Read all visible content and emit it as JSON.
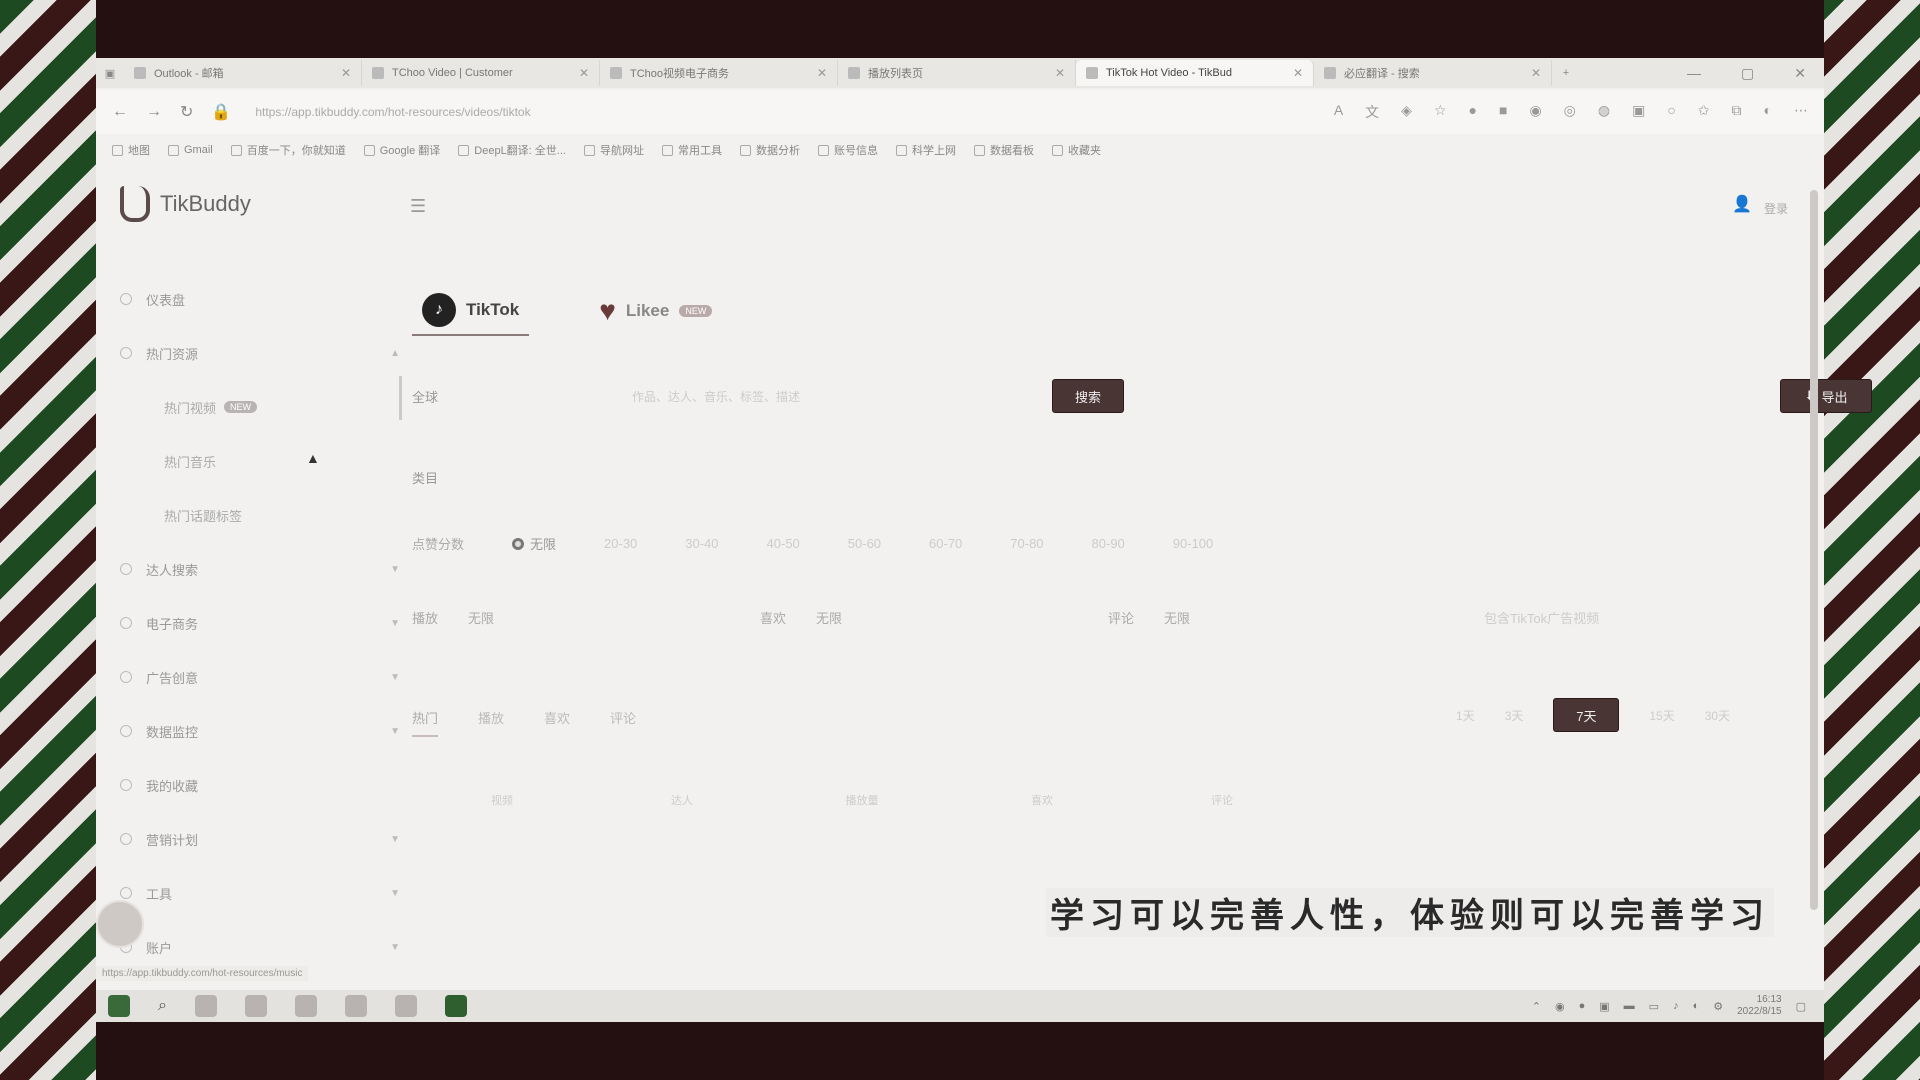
{
  "browser": {
    "tabs": [
      {
        "label": "Outlook - 邮箱",
        "active": false
      },
      {
        "label": "TChoo Video | Customer",
        "active": false
      },
      {
        "label": "TChoo视频电子商务",
        "active": false
      },
      {
        "label": "播放列表页",
        "active": false
      },
      {
        "label": "TikTok Hot Video - TikBud",
        "active": true
      },
      {
        "label": "必应翻译 - 搜索",
        "active": false
      }
    ],
    "new_tab": "+",
    "url": "https://app.tikbuddy.com/hot-resources/videos/tiktok",
    "bookmarks": [
      "地图",
      "Gmail",
      "百度一下，你就知道",
      "Google 翻译",
      "DeepL翻译: 全世...",
      "导航网址",
      "常用工具",
      "数据分析",
      "账号信息",
      "科学上网",
      "数据看板",
      "收藏夹"
    ],
    "status_url": "https://app.tikbuddy.com/hot-resources/music"
  },
  "app": {
    "logo": "TikBuddy",
    "menu_icon": "☰",
    "user_label": "登录"
  },
  "sidebar": {
    "items": [
      {
        "label": "仪表盘",
        "arrow": ""
      },
      {
        "label": "热门资源",
        "arrow": "▲"
      }
    ],
    "subitems": [
      {
        "label": "热门视频",
        "badge": "NEW"
      },
      {
        "label": "热门音乐",
        "badge": ""
      },
      {
        "label": "热门话题标签",
        "badge": ""
      }
    ],
    "items2": [
      {
        "label": "达人搜索",
        "arrow": "▼"
      },
      {
        "label": "电子商务",
        "arrow": "▼"
      },
      {
        "label": "广告创意",
        "arrow": "▼"
      },
      {
        "label": "数据监控",
        "arrow": "▼"
      },
      {
        "label": "我的收藏",
        "arrow": ""
      },
      {
        "label": "营销计划",
        "arrow": "▼"
      },
      {
        "label": "工具",
        "arrow": "▼"
      },
      {
        "label": "账户",
        "arrow": "▼"
      }
    ]
  },
  "platforms": [
    {
      "label": "TikTok",
      "active": true,
      "badge": ""
    },
    {
      "label": "Likee",
      "active": false,
      "badge": "NEW"
    }
  ],
  "filters": {
    "region": "全球",
    "search_placeholder": "作品、达人、音乐、标签、描述",
    "search_button": "搜索",
    "export_button": "导出"
  },
  "category_label": "类目",
  "likes": {
    "label": "点赞分数",
    "selected": "无限",
    "options": [
      "20-30",
      "30-40",
      "40-50",
      "50-60",
      "60-70",
      "70-80",
      "80-90",
      "90-100"
    ]
  },
  "stats": [
    {
      "label": "播放",
      "value": "无限"
    },
    {
      "label": "喜欢",
      "value": "无限"
    },
    {
      "label": "评论",
      "value": "无限"
    }
  ],
  "stats_note": "包含TikTok广告视频",
  "sort_tabs": [
    "热门",
    "播放",
    "喜欢",
    "评论"
  ],
  "time_filters": {
    "before": [
      "1天",
      "3天"
    ],
    "selected": "7天",
    "after": [
      "15天",
      "30天"
    ]
  },
  "table_headers": [
    "视频",
    "达人",
    "播放量",
    "喜欢",
    "评论"
  ],
  "caption": "学习可以完善人性，体验则可以完善学习",
  "taskbar": {
    "time": "16:13",
    "date": "2022/8/15"
  }
}
